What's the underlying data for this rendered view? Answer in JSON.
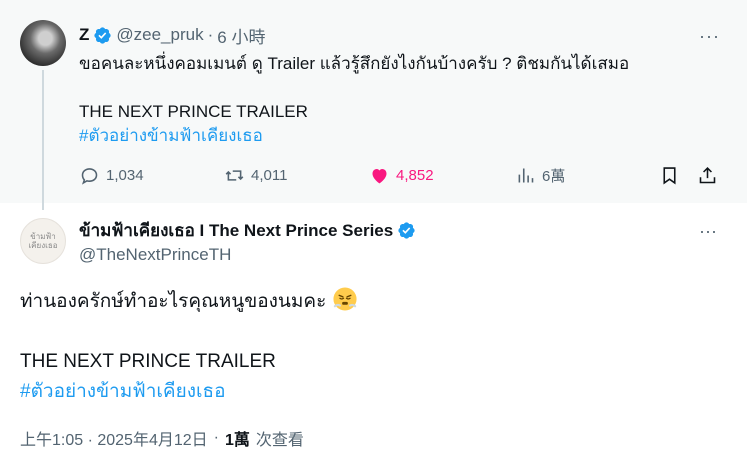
{
  "reply": {
    "name": "Z",
    "handle": "@zee_pruk",
    "separator": "·",
    "time": "6 小時",
    "text_line1": "ขอคนละหนึ่งคอมเมนต์ ดู Trailer แล้วรู้สึกยังไงกันบ้างครับ ? ติชมกันได้เสมอ",
    "text_line2": "THE NEXT PRINCE TRAILER",
    "hashtag": "#ตัวอย่างข้ามฟ้าเคียงเธอ",
    "more": "···",
    "replies": "1,034",
    "reposts": "4,011",
    "likes": "4,852",
    "views": "6萬",
    "colors": {
      "like": "#f91880",
      "link": "#1d9bf0",
      "muted": "#536471"
    }
  },
  "main": {
    "name": "ข้ามฟ้าเคียงเธอ I The Next Prince Series",
    "handle": "@TheNextPrinceTH",
    "avatar_text": "ข้ามฟ้า เคียงเธอ",
    "more": "···",
    "text_line1": "ท่านองครักษ์ทำอะไรคุณหนูของนมคะ",
    "emoji": "huffing-face-emoji",
    "text_line2": "THE NEXT PRINCE TRAILER",
    "hashtag": "#ตัวอย่างข้ามฟ้าเคียงเธอ",
    "timestamp": "上午1:05 · 2025年4月12日",
    "separator": "·",
    "view_count": "1萬",
    "view_label": "次查看"
  }
}
